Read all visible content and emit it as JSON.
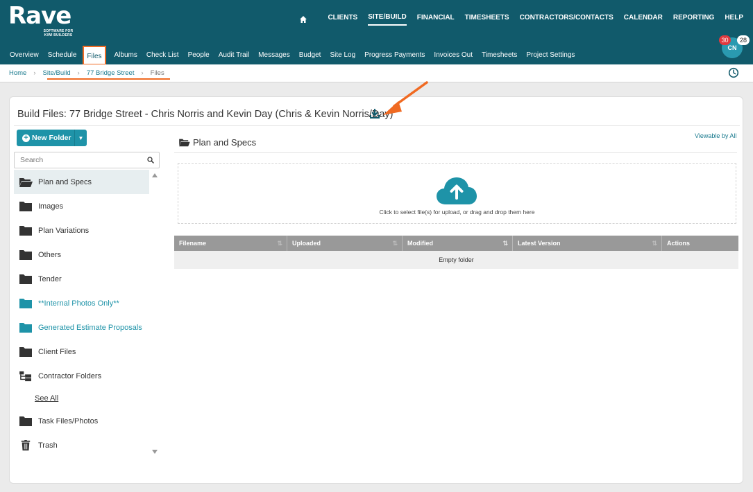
{
  "logo": {
    "word": "Rave",
    "sub": "SOFTWARE FOR KIWI BUILDERS"
  },
  "mainnav": {
    "items": [
      "CLIENTS",
      "SITE/BUILD",
      "FINANCIAL",
      "TIMESHEETS",
      "CONTRACTORS/CONTACTS",
      "CALENDAR",
      "REPORTING",
      "HELP"
    ],
    "active": "SITE/BUILD"
  },
  "subnav": {
    "items": [
      "Overview",
      "Schedule",
      "Files",
      "Albums",
      "Check List",
      "People",
      "Audit Trail",
      "Messages",
      "Budget",
      "Site Log",
      "Progress Payments",
      "Invoices Out",
      "Timesheets",
      "Project Settings"
    ],
    "active": "Files"
  },
  "user": {
    "initials": "CN",
    "badge_red": "30",
    "badge_white": "28"
  },
  "breadcrumb": {
    "home": "Home",
    "site": "Site/Build",
    "address": "77 Bridge Street",
    "current": "Files"
  },
  "card": {
    "title": "Build Files: 77 Bridge Street - Chris Norris and Kevin Day (Chris & Kevin Norris/Day)"
  },
  "left": {
    "new_folder": "New Folder",
    "search_placeholder": "Search",
    "folders": [
      {
        "label": "Plan and Specs",
        "icon": "folder-open-icon",
        "active": true
      },
      {
        "label": "Images",
        "icon": "folder-icon"
      },
      {
        "label": "Plan Variations",
        "icon": "folder-icon"
      },
      {
        "label": "Others",
        "icon": "folder-icon"
      },
      {
        "label": "Tender",
        "icon": "folder-icon"
      },
      {
        "label": "**Internal Photos Only**",
        "icon": "folder-teal-icon"
      },
      {
        "label": "Generated Estimate Proposals",
        "icon": "folder-teal-icon"
      },
      {
        "label": "Client Files",
        "icon": "folder-icon"
      },
      {
        "label": "Contractor Folders",
        "icon": "folder-tree-icon"
      },
      {
        "label": "See All",
        "icon": ""
      },
      {
        "label": "Task Files/Photos",
        "icon": "folder-icon"
      },
      {
        "label": "Trash",
        "icon": "trash-icon"
      }
    ]
  },
  "right": {
    "title": "Plan and Specs",
    "viewable": "Viewable by All",
    "dropzone_text": "Click to select file(s) for upload, or drag and drop them here",
    "columns": [
      "Filename",
      "Uploaded",
      "Modified",
      "Latest Version",
      "Actions"
    ],
    "empty": "Empty folder"
  },
  "colors": {
    "header": "#115a6b",
    "accent": "#1e93a8",
    "annotation": "#f06a22"
  }
}
